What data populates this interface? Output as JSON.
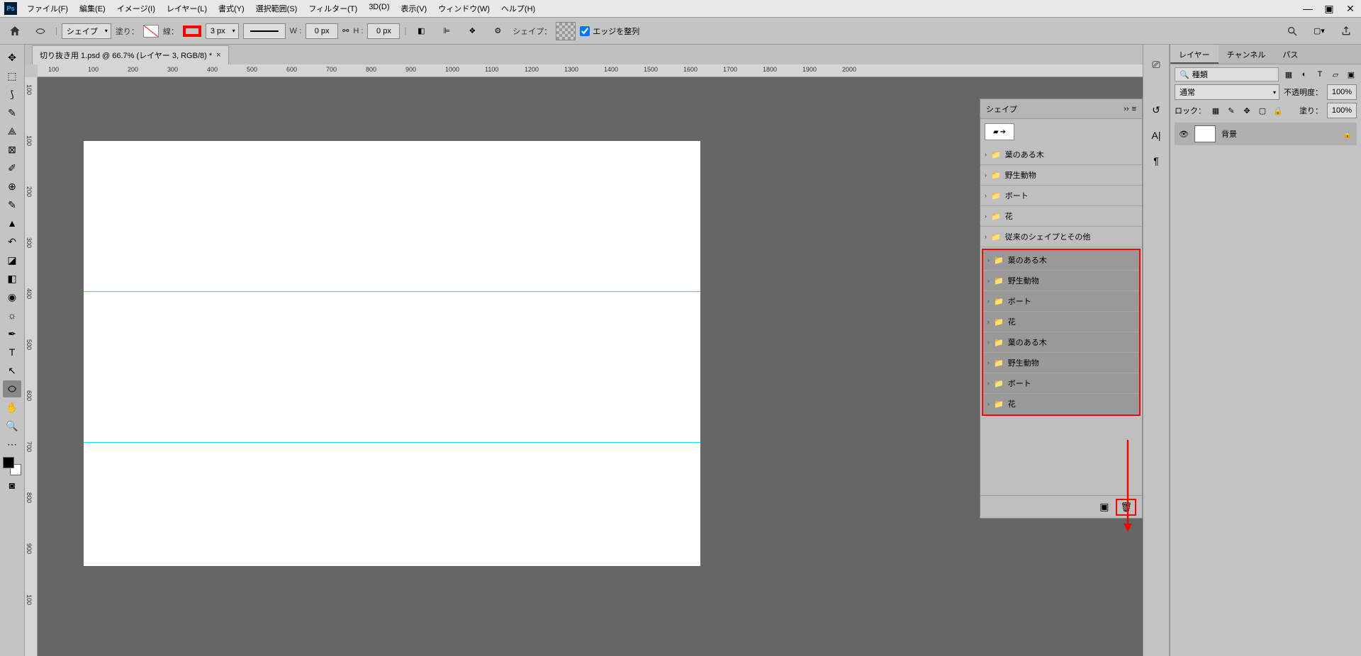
{
  "app": {
    "icon_text": "Ps"
  },
  "menu": [
    "ファイル(F)",
    "編集(E)",
    "イメージ(I)",
    "レイヤー(L)",
    "書式(Y)",
    "選択範囲(S)",
    "フィルター(T)",
    "3D(D)",
    "表示(V)",
    "ウィンドウ(W)",
    "ヘルプ(H)"
  ],
  "optbar": {
    "shape_mode": "シェイプ",
    "fill_label": "塗り：",
    "stroke_label": "線：",
    "stroke_width": "3 px",
    "w_label": "W :",
    "w_value": "0 px",
    "h_label": "H :",
    "h_value": "0 px",
    "shape_label": "シェイプ：",
    "align_edges": "エッジを整列"
  },
  "doc_tab": "切り抜き用 1.psd @ 66.7% (レイヤー 3, RGB/8) *",
  "ruler_ticks": [
    "100",
    "100",
    "200",
    "300",
    "400",
    "500",
    "600",
    "700",
    "800",
    "900",
    "1000",
    "1100",
    "1200",
    "1300",
    "1400",
    "1500",
    "1600",
    "1700",
    "1800",
    "1900",
    "2000"
  ],
  "ruler_v": [
    "100",
    "100",
    "200",
    "300",
    "400",
    "500",
    "600",
    "700",
    "800",
    "900",
    "100"
  ],
  "shape_panel": {
    "title": "シェイプ",
    "folders": [
      "葉のある木",
      "野生動物",
      "ボート",
      "花",
      "従来のシェイプとその他"
    ],
    "selected_folders": [
      "葉のある木",
      "野生動物",
      "ボート",
      "花",
      "葉のある木",
      "野生動物",
      "ボート",
      "花"
    ]
  },
  "right_tabs": [
    "レイヤー",
    "チャンネル",
    "パス"
  ],
  "layers": {
    "filter_placeholder": "種類",
    "blend_mode": "通常",
    "opacity_label": "不透明度：",
    "opacity": "100%",
    "lock_label": "ロック：",
    "fill_label": "塗り：",
    "fill_value": "100%",
    "layer_name": "背景"
  }
}
